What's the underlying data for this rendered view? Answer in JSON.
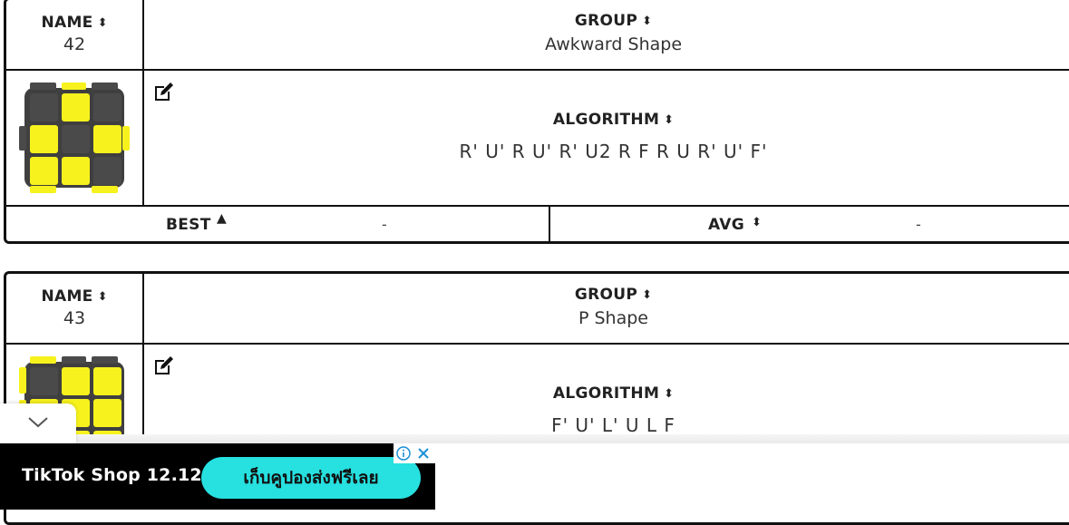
{
  "colors": {
    "yellow": "#f7f21d",
    "dark": "#3f3f3f",
    "cyan": "#27e0e0"
  },
  "cards": [
    {
      "name_label": "NAME",
      "name_value": "42",
      "group_label": "GROUP",
      "group_value": "Awkward Shape",
      "algorithm_label": "ALGORITHM",
      "algorithm_value": "R' U' R U' R' U2 R F R U R' U' F'",
      "best_label": "BEST",
      "best_value": "-",
      "avg_label": "AVG",
      "avg_value": "-",
      "cube_pattern": [
        [
          "D",
          "Y",
          "D"
        ],
        [
          "Y",
          "D",
          "Y"
        ],
        [
          "Y",
          "Y",
          "D"
        ]
      ]
    },
    {
      "name_label": "NAME",
      "name_value": "43",
      "group_label": "GROUP",
      "group_value": "P Shape",
      "algorithm_label": "ALGORITHM",
      "algorithm_value": "F' U' L' U L F",
      "cube_pattern": [
        [
          "D",
          "Y",
          "Y"
        ],
        [
          "Y",
          "Y",
          "Y"
        ],
        [
          "D",
          "Y",
          "Y"
        ]
      ]
    }
  ],
  "ad": {
    "brand_text": "TikTok Shop 12.12",
    "button_text": "เก็บคูปองส่งฟรีเลย",
    "info_icon": "info-icon",
    "close_icon": "close-icon"
  },
  "collapse_icon": "chevron-down-icon"
}
